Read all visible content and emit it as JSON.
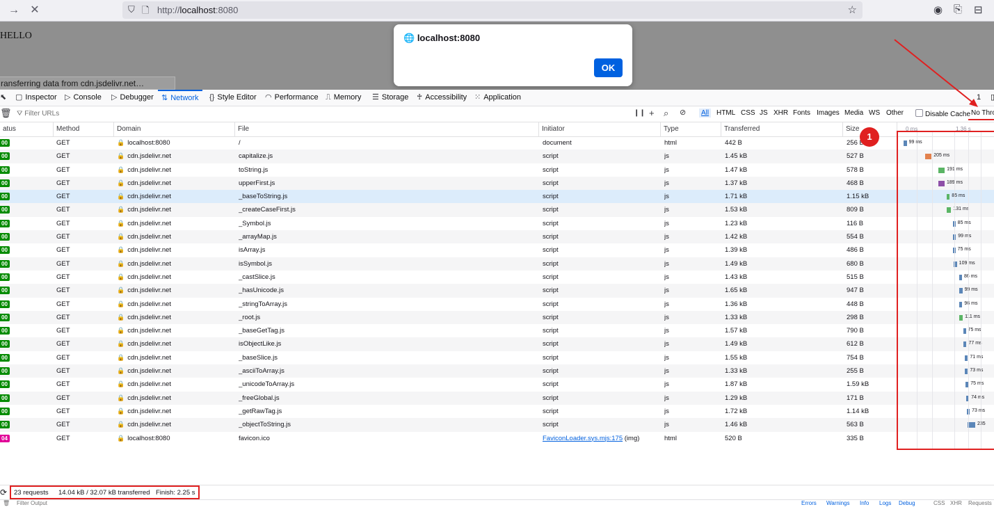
{
  "browser": {
    "url_scheme": "http://",
    "url_host": "localhost",
    "url_port": ":8080"
  },
  "page": {
    "hello_text": "HELLO",
    "loading_text": "ransferring data from cdn.jsdelivr.net…"
  },
  "dialog": {
    "title": "localhost:8080",
    "ok_label": "OK"
  },
  "devtools": {
    "tabs": [
      "Inspector",
      "Console",
      "Debugger",
      "Network",
      "Style Editor",
      "Performance",
      "Memory",
      "Storage",
      "Accessibility",
      "Application"
    ],
    "active_tab": "Network",
    "error_count": "1"
  },
  "filterbar": {
    "placeholder": "Filter URLs",
    "types": [
      "All",
      "HTML",
      "CSS",
      "JS",
      "XHR",
      "Fonts",
      "Images",
      "Media",
      "WS",
      "Other"
    ],
    "disable_cache": "Disable Cache",
    "throttle": "No Thro"
  },
  "columns": [
    "atus",
    "Method",
    "Domain",
    "File",
    "Initiator",
    "Type",
    "Transferred",
    "Size"
  ],
  "timeline_labels": [
    "0 ms",
    "1.36 s"
  ],
  "requests": [
    {
      "status": "00",
      "method": "GET",
      "domain": "localhost:8080",
      "file": "/",
      "initiator": "document",
      "type": "html",
      "transferred": "442 B",
      "size": "256 B",
      "time": "99 ms",
      "start": 0.0,
      "dur": 0.099,
      "color": "#5b86b8"
    },
    {
      "status": "00",
      "method": "GET",
      "domain": "cdn.jsdelivr.net",
      "file": "capitalize.js",
      "initiator": "script",
      "type": "js",
      "transferred": "1.45 kB",
      "size": "527 B",
      "time": "205 ms",
      "start": 0.33,
      "dur": 0.205,
      "color": "#e2814d"
    },
    {
      "status": "00",
      "method": "GET",
      "domain": "cdn.jsdelivr.net",
      "file": "toString.js",
      "initiator": "script",
      "type": "js",
      "transferred": "1.47 kB",
      "size": "578 B",
      "time": "191 ms",
      "start": 0.54,
      "dur": 0.191,
      "color": "#5bb565"
    },
    {
      "status": "00",
      "method": "GET",
      "domain": "cdn.jsdelivr.net",
      "file": "upperFirst.js",
      "initiator": "script",
      "type": "js",
      "transferred": "1.37 kB",
      "size": "468 B",
      "time": "189 ms",
      "start": 0.54,
      "dur": 0.189,
      "color": "#8e4fa8"
    },
    {
      "status": "00",
      "method": "GET",
      "domain": "cdn.jsdelivr.net",
      "file": "_baseToString.js",
      "initiator": "script",
      "type": "js",
      "transferred": "1.71 kB",
      "size": "1.15 kB",
      "time": "85 ms",
      "start": 0.67,
      "dur": 0.085,
      "color": "#5bb565"
    },
    {
      "status": "00",
      "method": "GET",
      "domain": "cdn.jsdelivr.net",
      "file": "_createCaseFirst.js",
      "initiator": "script",
      "type": "js",
      "transferred": "1.53 kB",
      "size": "809 B",
      "time": "131 ms",
      "start": 0.67,
      "dur": 0.131,
      "color": "#5bb565"
    },
    {
      "status": "00",
      "method": "GET",
      "domain": "cdn.jsdelivr.net",
      "file": "_Symbol.js",
      "initiator": "script",
      "type": "js",
      "transferred": "1.23 kB",
      "size": "116 B",
      "time": "85 ms",
      "start": 0.76,
      "dur": 0.085,
      "color": "#5b86b8"
    },
    {
      "status": "00",
      "method": "GET",
      "domain": "cdn.jsdelivr.net",
      "file": "_arrayMap.js",
      "initiator": "script",
      "type": "js",
      "transferred": "1.42 kB",
      "size": "554 B",
      "time": "99 ms",
      "start": 0.76,
      "dur": 0.099,
      "color": "#5b86b8"
    },
    {
      "status": "00",
      "method": "GET",
      "domain": "cdn.jsdelivr.net",
      "file": "isArray.js",
      "initiator": "script",
      "type": "js",
      "transferred": "1.39 kB",
      "size": "486 B",
      "time": "75 ms",
      "start": 0.76,
      "dur": 0.075,
      "color": "#5b86b8"
    },
    {
      "status": "00",
      "method": "GET",
      "domain": "cdn.jsdelivr.net",
      "file": "isSymbol.js",
      "initiator": "script",
      "type": "js",
      "transferred": "1.49 kB",
      "size": "680 B",
      "time": "109 ms",
      "start": 0.77,
      "dur": 0.109,
      "color": "#5b86b8"
    },
    {
      "status": "00",
      "method": "GET",
      "domain": "cdn.jsdelivr.net",
      "file": "_castSlice.js",
      "initiator": "script",
      "type": "js",
      "transferred": "1.43 kB",
      "size": "515 B",
      "time": "86 ms",
      "start": 0.86,
      "dur": 0.086,
      "color": "#5b86b8"
    },
    {
      "status": "00",
      "method": "GET",
      "domain": "cdn.jsdelivr.net",
      "file": "_hasUnicode.js",
      "initiator": "script",
      "type": "js",
      "transferred": "1.65 kB",
      "size": "947 B",
      "time": "99 ms",
      "start": 0.86,
      "dur": 0.099,
      "color": "#5b86b8"
    },
    {
      "status": "00",
      "method": "GET",
      "domain": "cdn.jsdelivr.net",
      "file": "_stringToArray.js",
      "initiator": "script",
      "type": "js",
      "transferred": "1.36 kB",
      "size": "448 B",
      "time": "96 ms",
      "start": 0.86,
      "dur": 0.096,
      "color": "#5b86b8"
    },
    {
      "status": "00",
      "method": "GET",
      "domain": "cdn.jsdelivr.net",
      "file": "_root.js",
      "initiator": "script",
      "type": "js",
      "transferred": "1.33 kB",
      "size": "298 B",
      "time": "111 ms",
      "start": 0.86,
      "dur": 0.111,
      "color": "#5bb565"
    },
    {
      "status": "00",
      "method": "GET",
      "domain": "cdn.jsdelivr.net",
      "file": "_baseGetTag.js",
      "initiator": "script",
      "type": "js",
      "transferred": "1.57 kB",
      "size": "790 B",
      "time": "75 ms",
      "start": 0.92,
      "dur": 0.075,
      "color": "#5b86b8"
    },
    {
      "status": "00",
      "method": "GET",
      "domain": "cdn.jsdelivr.net",
      "file": "isObjectLike.js",
      "initiator": "script",
      "type": "js",
      "transferred": "1.49 kB",
      "size": "612 B",
      "time": "77 ms",
      "start": 0.93,
      "dur": 0.077,
      "color": "#5b86b8"
    },
    {
      "status": "00",
      "method": "GET",
      "domain": "cdn.jsdelivr.net",
      "file": "_baseSlice.js",
      "initiator": "script",
      "type": "js",
      "transferred": "1.55 kB",
      "size": "754 B",
      "time": "71 ms",
      "start": 0.95,
      "dur": 0.071,
      "color": "#5b86b8"
    },
    {
      "status": "00",
      "method": "GET",
      "domain": "cdn.jsdelivr.net",
      "file": "_asciiToArray.js",
      "initiator": "script",
      "type": "js",
      "transferred": "1.33 kB",
      "size": "255 B",
      "time": "73 ms",
      "start": 0.95,
      "dur": 0.073,
      "color": "#5b86b8"
    },
    {
      "status": "00",
      "method": "GET",
      "domain": "cdn.jsdelivr.net",
      "file": "_unicodeToArray.js",
      "initiator": "script",
      "type": "js",
      "transferred": "1.87 kB",
      "size": "1.59 kB",
      "time": "75 ms",
      "start": 0.96,
      "dur": 0.075,
      "color": "#5b86b8"
    },
    {
      "status": "00",
      "method": "GET",
      "domain": "cdn.jsdelivr.net",
      "file": "_freeGlobal.js",
      "initiator": "script",
      "type": "js",
      "transferred": "1.29 kB",
      "size": "171 B",
      "time": "74 ms",
      "start": 0.97,
      "dur": 0.074,
      "color": "#5b86b8"
    },
    {
      "status": "00",
      "method": "GET",
      "domain": "cdn.jsdelivr.net",
      "file": "_getRawTag.js",
      "initiator": "script",
      "type": "js",
      "transferred": "1.72 kB",
      "size": "1.14 kB",
      "time": "73 ms",
      "start": 0.98,
      "dur": 0.073,
      "color": "#5b86b8"
    },
    {
      "status": "00",
      "method": "GET",
      "domain": "cdn.jsdelivr.net",
      "file": "_objectToString.js",
      "initiator": "script",
      "type": "js",
      "transferred": "1.46 kB",
      "size": "563 B",
      "time": "235",
      "start": 0.99,
      "dur": 0.235,
      "color": "#5b86b8"
    },
    {
      "status": "04",
      "method": "GET",
      "domain": "localhost:8080",
      "file": "favicon.ico",
      "initiator": "FaviconLoader.sys.mjs:175",
      "initiator_suffix": "(img)",
      "type": "html",
      "transferred": "520 B",
      "size": "335 B",
      "time": "",
      "start": 0,
      "dur": 0,
      "color": "#5b86b8"
    }
  ],
  "selected_row": 4,
  "annotation_number": "1",
  "summary": {
    "requests": "23 requests",
    "transferred": "14.04 kB / 32.07 kB transferred",
    "finish": "Finish: 2.25 s"
  },
  "console": {
    "filter_placeholder": "Filter Output",
    "levels": [
      "Errors",
      "Warnings",
      "Info",
      "Logs",
      "Debug"
    ],
    "types": [
      "CSS",
      "XHR",
      "Requests"
    ]
  },
  "colors": {
    "accent": "#0060df",
    "annotation_red": "#e02020",
    "status_ok": "#058b00",
    "status_404": "#e10098"
  }
}
